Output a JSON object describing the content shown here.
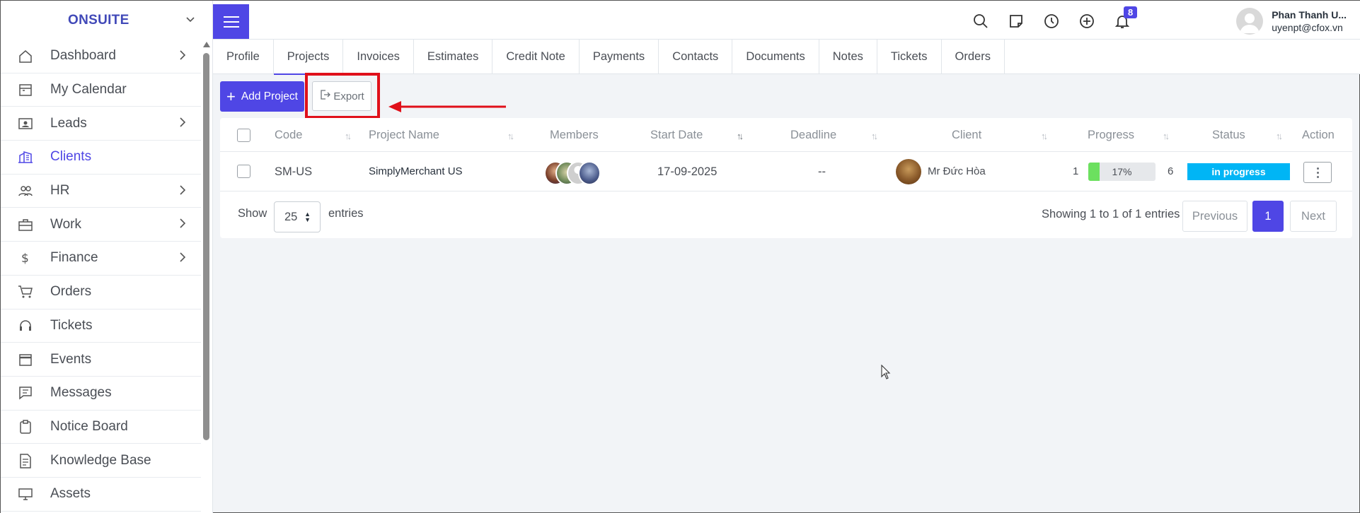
{
  "brand": "ONSUITE",
  "sidebar": {
    "items": [
      {
        "label": "Dashboard",
        "icon": "home-icon",
        "has_arrow": true
      },
      {
        "label": "My Calendar",
        "icon": "calendar-icon",
        "has_arrow": false
      },
      {
        "label": "Leads",
        "icon": "contact-card-icon",
        "has_arrow": true
      },
      {
        "label": "Clients",
        "icon": "building-icon",
        "has_arrow": false,
        "active": true
      },
      {
        "label": "HR",
        "icon": "people-icon",
        "has_arrow": true
      },
      {
        "label": "Work",
        "icon": "briefcase-icon",
        "has_arrow": true
      },
      {
        "label": "Finance",
        "icon": "dollar-icon",
        "has_arrow": true
      },
      {
        "label": "Orders",
        "icon": "cart-icon",
        "has_arrow": false
      },
      {
        "label": "Tickets",
        "icon": "headset-icon",
        "has_arrow": false
      },
      {
        "label": "Events",
        "icon": "event-icon",
        "has_arrow": false
      },
      {
        "label": "Messages",
        "icon": "message-icon",
        "has_arrow": false
      },
      {
        "label": "Notice Board",
        "icon": "clipboard-icon",
        "has_arrow": false
      },
      {
        "label": "Knowledge Base",
        "icon": "document-icon",
        "has_arrow": false
      },
      {
        "label": "Assets",
        "icon": "monitor-icon",
        "has_arrow": false
      }
    ]
  },
  "header": {
    "notification_count": "8",
    "user_name": "Phan Thanh U...",
    "user_email": "uyenpt@cfox.vn"
  },
  "tabs": [
    "Profile",
    "Projects",
    "Invoices",
    "Estimates",
    "Credit Note",
    "Payments",
    "Contacts",
    "Documents",
    "Notes",
    "Tickets",
    "Orders"
  ],
  "active_tab": "Projects",
  "actions": {
    "add_label": "Add Project",
    "export_label": "Export"
  },
  "table": {
    "columns": [
      "Code",
      "Project Name",
      "Members",
      "Start Date",
      "Deadline",
      "Client",
      "Progress",
      "Status",
      "Action"
    ],
    "rows": [
      {
        "code": "SM-US",
        "project_name": "SimplyMerchant US",
        "start_date": "17-09-2025",
        "deadline": "--",
        "client": "Mr Đức Hòa",
        "progress_left": "1",
        "progress_percent": "17%",
        "progress_value": 17,
        "progress_right": "6",
        "status": "in progress"
      }
    ]
  },
  "pagination": {
    "show_label": "Show",
    "entries_value": "25",
    "entries_label": "entries",
    "summary": "Showing 1 to 1 of 1 entries",
    "previous": "Previous",
    "current_page": "1",
    "next": "Next"
  },
  "colors": {
    "accent": "#4f46e5",
    "status": "#00b5f5",
    "progress": "#6ce05f",
    "highlight": "#e0101a"
  }
}
